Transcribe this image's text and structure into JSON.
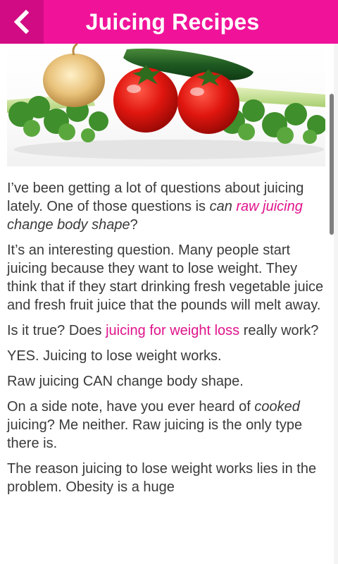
{
  "header": {
    "title": "Juicing Recipes",
    "accent_color": "#f0139a",
    "back_button_color": "#d10b84",
    "back_icon": "chevron-left-icon"
  },
  "hero": {
    "image": "vegetables-photo"
  },
  "article": {
    "p1": {
      "text_a": "I’ve been getting a lot of questions about juicing lately. One of those questions is ",
      "em_a": "can ",
      "link": "raw juicing",
      "em_b": " change body shape",
      "text_b": "?"
    },
    "p2": "It’s an interesting question. Many people start juicing because they want to lose weight. They think that if they start drinking fresh vegetable juice and fresh fruit juice that the pounds will melt away.",
    "p3": {
      "text_a": "Is it true? Does ",
      "link": "juicing for weight loss",
      "text_b": " really work?"
    },
    "p4": "YES. Juicing to lose weight works.",
    "p5": "Raw juicing CAN change body shape.",
    "p6": {
      "text_a": "On a side note, have you ever heard of ",
      "em": "cooked",
      "text_b": " juicing? Me neither. Raw juicing is the only type there is."
    },
    "p7": "The reason juicing to lose weight works lies in the problem. Obesity is a huge",
    "link_color": "#e0148c",
    "text_color": "#3a3a3a"
  }
}
